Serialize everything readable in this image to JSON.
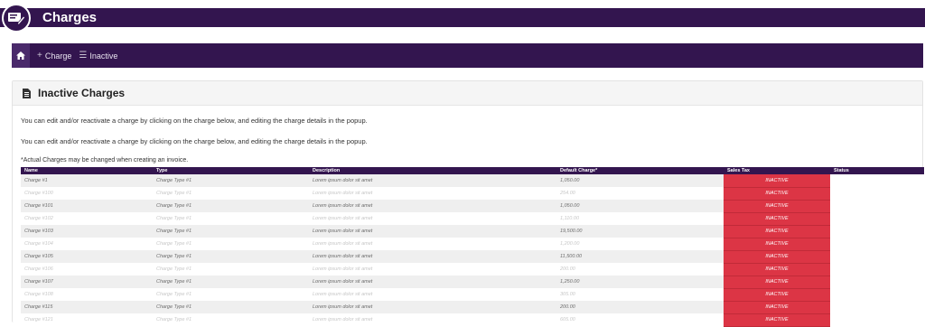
{
  "header": {
    "title": "Charges",
    "logo_icon": "invoice-pen-icon",
    "bar_color": "#33154f"
  },
  "nav": {
    "add_label": "Charge",
    "inactive_label": "Inactive"
  },
  "panel": {
    "title": "Inactive Charges",
    "info1": "You can edit and/or reactivate a charge by clicking on the charge below, and editing the charge details in the popup.",
    "info2": "You can edit and/or reactivate a charge by clicking on the charge below, and editing the charge details in the popup.",
    "note": "*Actual Charges may be changed when creating an invoice."
  },
  "table": {
    "headers": [
      "Name",
      "Type",
      "Description",
      "Default Charge*",
      "Sales Tax",
      "Status"
    ],
    "rows": [
      {
        "name": "Charge #1",
        "type": "Charge Type #1",
        "desc": "Lorem ipsum dolor sit amet",
        "charge": "1,050.00",
        "tax": "INACTIVE",
        "status": ""
      },
      {
        "name": "Charge #100",
        "type": "Charge Type #1",
        "desc": "Lorem ipsum dolor sit amet",
        "charge": "254.00",
        "tax": "INACTIVE",
        "status": ""
      },
      {
        "name": "Charge #101",
        "type": "Charge Type #1",
        "desc": "Lorem ipsum dolor sit amet",
        "charge": "1,050.00",
        "tax": "INACTIVE",
        "status": ""
      },
      {
        "name": "Charge #102",
        "type": "Charge Type #1",
        "desc": "Lorem ipsum dolor sit amet",
        "charge": "1,110.00",
        "tax": "INACTIVE",
        "status": ""
      },
      {
        "name": "Charge #103",
        "type": "Charge Type #1",
        "desc": "Lorem ipsum dolor sit amet",
        "charge": "19,500.00",
        "tax": "INACTIVE",
        "status": ""
      },
      {
        "name": "Charge #104",
        "type": "Charge Type #1",
        "desc": "Lorem ipsum dolor sit amet",
        "charge": "1,200.00",
        "tax": "INACTIVE",
        "status": ""
      },
      {
        "name": "Charge #105",
        "type": "Charge Type #1",
        "desc": "Lorem ipsum dolor sit amet",
        "charge": "11,500.00",
        "tax": "INACTIVE",
        "status": ""
      },
      {
        "name": "Charge #106",
        "type": "Charge Type #1",
        "desc": "Lorem ipsum dolor sit amet",
        "charge": "200.00",
        "tax": "INACTIVE",
        "status": ""
      },
      {
        "name": "Charge #107",
        "type": "Charge Type #1",
        "desc": "Lorem ipsum dolor sit amet",
        "charge": "1,250.00",
        "tax": "INACTIVE",
        "status": ""
      },
      {
        "name": "Charge #108",
        "type": "Charge Type #1",
        "desc": "Lorem ipsum dolor sit amet",
        "charge": "305.00",
        "tax": "INACTIVE",
        "status": ""
      },
      {
        "name": "Charge #115",
        "type": "Charge Type #1",
        "desc": "Lorem ipsum dolor sit amet",
        "charge": "200.00",
        "tax": "INACTIVE",
        "status": ""
      },
      {
        "name": "Charge #121",
        "type": "Charge Type #1",
        "desc": "Lorem ipsum dolor sit amet",
        "charge": "605.00",
        "tax": "INACTIVE",
        "status": ""
      }
    ]
  },
  "colors": {
    "primary": "#33154f",
    "inactive": "#dc3545",
    "row_alt": "#efefef"
  }
}
